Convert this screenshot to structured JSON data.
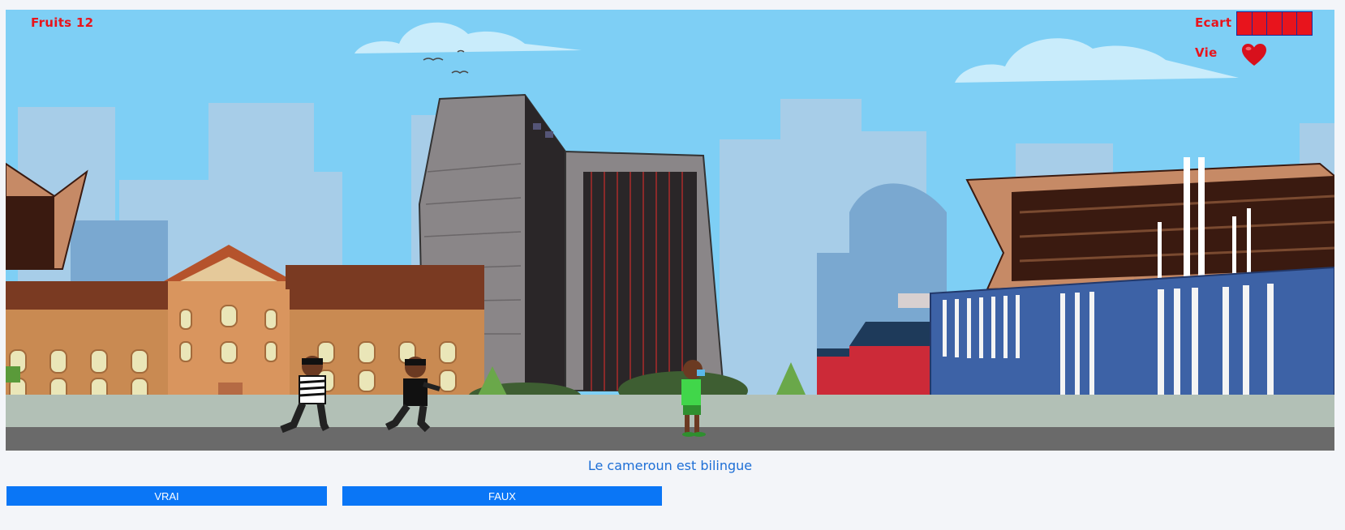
{
  "hud": {
    "fruits_label": "Fruits 12",
    "ecart_label": "Ecart",
    "ecart_segments": 5,
    "vie_label": "Vie",
    "lives": 1
  },
  "question": {
    "text": "Le cameroun est bilingue"
  },
  "answers": {
    "true_label": "VRAI",
    "false_label": "FAUX"
  },
  "colors": {
    "hud_text": "#e8141c",
    "sky": "#7ecff5",
    "button": "#0a76f6",
    "question_text": "#1e6fd6"
  },
  "scene": {
    "characters": [
      "thief-striped",
      "thief-black",
      "child-green-masked"
    ],
    "icons": [
      "heart-icon"
    ]
  }
}
